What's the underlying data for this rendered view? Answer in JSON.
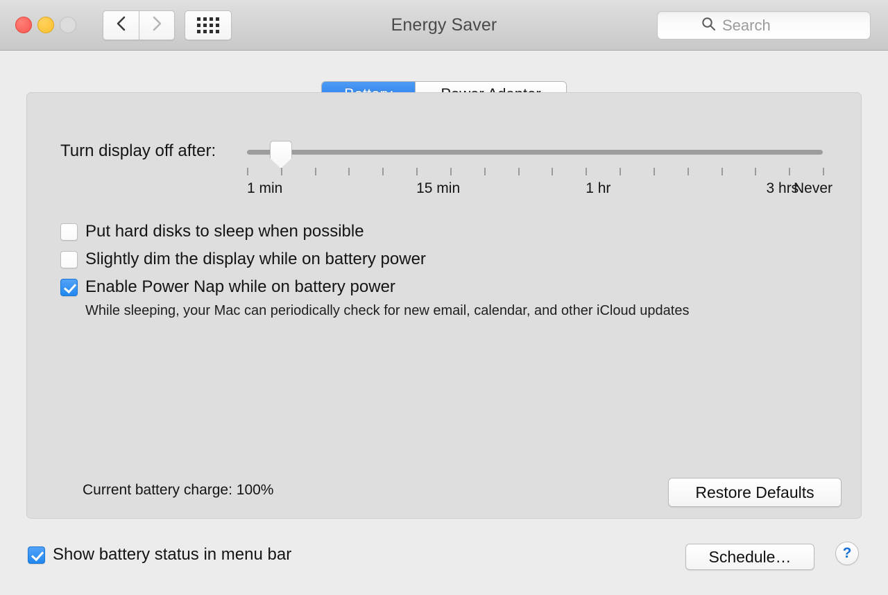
{
  "window": {
    "title": "Energy Saver",
    "traffic_lights": [
      "close",
      "minimize",
      "zoom"
    ]
  },
  "toolbar": {
    "back_icon": "chevron-left-icon",
    "forward_icon": "chevron-right-icon",
    "apps_icon": "grid-apps-icon",
    "search": {
      "placeholder": "Search",
      "value": "",
      "icon": "search-icon"
    }
  },
  "tabs": [
    {
      "label": "Battery",
      "active": true
    },
    {
      "label": "Power Adapter",
      "active": false
    }
  ],
  "slider": {
    "label": "Turn display off after:",
    "value_index": 1,
    "tick_count": 18,
    "tick_labels": [
      {
        "text": "1 min",
        "pos": 0
      },
      {
        "text": "15 min",
        "pos": 5
      },
      {
        "text": "1 hr",
        "pos": 10
      },
      {
        "text": "3 hrs",
        "pos": 16
      },
      {
        "text": "Never",
        "pos": 17
      }
    ]
  },
  "options": [
    {
      "label": "Put hard disks to sleep when possible",
      "checked": false,
      "name": "put-hard-disks-to-sleep"
    },
    {
      "label": "Slightly dim the display while on battery power",
      "checked": false,
      "name": "slightly-dim-display"
    },
    {
      "label": "Enable Power Nap while on battery power",
      "checked": true,
      "name": "enable-power-nap",
      "description": "While sleeping, your Mac can periodically check for new email, calendar, and other iCloud updates"
    }
  ],
  "footer": {
    "battery_charge": "Current battery charge: 100%",
    "restore_defaults": "Restore Defaults"
  },
  "bottom": {
    "menu_bar_option": {
      "label": "Show battery status in menu bar",
      "checked": true
    },
    "schedule_button": "Schedule…",
    "help_button": "?"
  },
  "colors": {
    "accent_blue": "#1874e8",
    "checkbox_blue": "#2287f0",
    "help_blue": "#1a72d8",
    "window_bg": "#ececec",
    "panel_bg": "#dedede"
  }
}
